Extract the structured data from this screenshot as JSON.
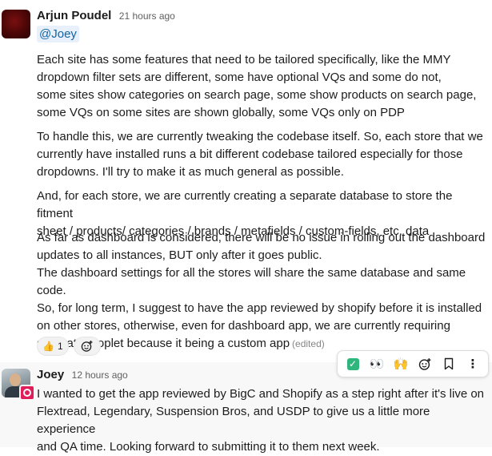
{
  "message1": {
    "author": "Arjun Poudel",
    "timestamp": "21 hours ago",
    "mention": "@Joey",
    "paragraphs": [
      "Each site has some features that need to be tailored specifically, like the MMY\ndropdown filter sets are different, some have optional VQs and some do not,\nsome sites show categories on search page, some show products on search page,\nsome VQs on some sites  are shown globally, some VQs only on PDP",
      "To handle this, we are currently tweaking the codebase itself. So, each store that we\ncurrently have installed runs a bit different codebase tailored especially for those\ndropdowns. I'll try to make it as much general as possible.",
      "And, for each store, we are currently creating a separate database to store the fitment\nsheet / products/ categories / brands / metafields / custom-fields, etc. data",
      "As far as dashboard is considered, there will be no issue in rolling out the dashboard\nupdates to all instances, BUT only after it goes public.\nThe dashboard settings  for all the stores will share the same database and same code.\nSo, for long term, I suggest to  have the app reviewed by shopify before it is installed\non other stores, otherwise,  even for dashboard app, we are currently requiring\nseparate droplet because it being a custom app"
    ],
    "edited_label": "(edited)",
    "reactions": [
      {
        "emoji": "👍",
        "count": "1",
        "icon": "thumbs-up-icon"
      }
    ],
    "add_reaction_icon": "add-reaction-icon"
  },
  "message2": {
    "author": "Joey",
    "timestamp": "12 hours ago",
    "text": "I wanted to get the app reviewed by BigC and Shopify as a step right after it's live on\nFlextread, Legendary, Suspension Bros, and USDP to give us a little more experience\nand QA time. Looking forward to submitting it to them next week."
  },
  "toolbar": {
    "actions": [
      {
        "icon": "check-mark-icon",
        "glyph": "✓"
      },
      {
        "icon": "eyes-icon",
        "glyph": "👀"
      },
      {
        "icon": "raised-hands-icon",
        "glyph": "🙌"
      },
      {
        "icon": "add-reaction-icon",
        "glyph": "☺"
      },
      {
        "icon": "bookmark-icon",
        "glyph": ""
      },
      {
        "icon": "more-actions-icon",
        "glyph": "⋮"
      }
    ]
  },
  "colors": {
    "mention_bg": "#e8f0fb",
    "mention_text": "#1264a3",
    "hover_bg": "#f8f8f8",
    "app_badge": "#e01e5a",
    "check_green": "#2eb67d"
  }
}
